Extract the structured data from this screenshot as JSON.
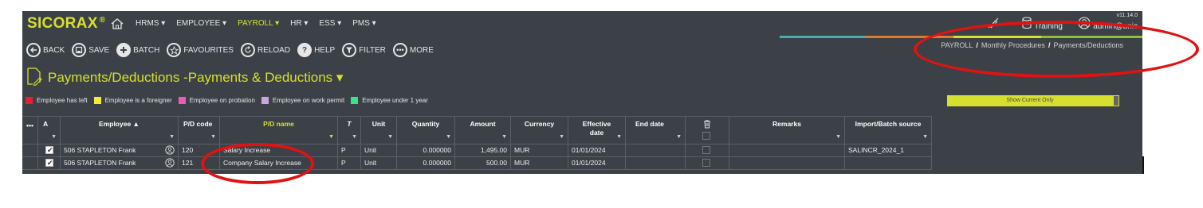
{
  "app": {
    "logo": "SICORAX",
    "logo_mark": "®",
    "version": "v11.14.0",
    "environment": "Training",
    "user": "admin@unic"
  },
  "menu": [
    {
      "label": "HRMS ▾",
      "active": false
    },
    {
      "label": "EMPLOYEE ▾",
      "active": false
    },
    {
      "label": "PAYROLL ▾",
      "active": true
    },
    {
      "label": "HR ▾",
      "active": false
    },
    {
      "label": "ESS ▾",
      "active": false
    },
    {
      "label": "PMS ▾",
      "active": false
    }
  ],
  "toolbar": {
    "back": "BACK",
    "save": "SAVE",
    "batch": "BATCH",
    "favourites": "FAVOURITES",
    "reload": "RELOAD",
    "help": "HELP",
    "filter": "FILTER",
    "more": "MORE"
  },
  "breadcrumb": {
    "level1": "PAYROLL",
    "level2": "Monthly Procedures",
    "level3": "Payments/Deductions"
  },
  "page": {
    "title": "Payments/Deductions -Payments & Deductions ▾"
  },
  "legend": [
    {
      "label": "Employee has left",
      "color": "#e8202a"
    },
    {
      "label": "Employee is a foreigner",
      "color": "#f2ea3c"
    },
    {
      "label": "Employee on probation",
      "color": "#ee5bb6"
    },
    {
      "label": "Employee on work permit",
      "color": "#c9a6e0"
    },
    {
      "label": "Employee under 1 year",
      "color": "#3ee08a"
    }
  ],
  "show_current": "Show Current Only",
  "grid": {
    "columns": {
      "menu": "•••",
      "active": "A",
      "employee": "Employee ▲",
      "pd_code": "P/D code",
      "pd_name": "P/D name",
      "type": "T",
      "unit": "Unit",
      "quantity": "Quantity",
      "amount": "Amount",
      "currency": "Currency",
      "effective_date": "Effective date",
      "end_date": "End date",
      "delete": "",
      "remarks": "Remarks",
      "import_source": "Import/Batch source"
    },
    "rows": [
      {
        "active": true,
        "employee": "506 STAPLETON Frank",
        "pd_code": "120",
        "pd_name": "Salary Increase",
        "type": "P",
        "unit": "Unit",
        "quantity": "0.000000",
        "amount": "1,495.00",
        "currency": "MUR",
        "effective_date": "01/01/2024",
        "end_date": "",
        "remarks": "",
        "import_source": "SALINCR_2024_1"
      },
      {
        "active": true,
        "employee": "506 STAPLETON Frank",
        "pd_code": "121",
        "pd_name": "Company Salary Increase",
        "type": "P",
        "unit": "Unit",
        "quantity": "0.000000",
        "amount": "500.00",
        "currency": "MUR",
        "effective_date": "01/01/2024",
        "end_date": "",
        "remarks": "",
        "import_source": ""
      }
    ]
  },
  "colors": {
    "accent": "#d7e02f",
    "background": "#3b4146",
    "annotation": "#e01212",
    "bar_teal": "#4fa9b5",
    "bar_orange": "#e07a2a",
    "bar_yellow": "#d7e02f",
    "bar_green": "#8fbf3a"
  }
}
